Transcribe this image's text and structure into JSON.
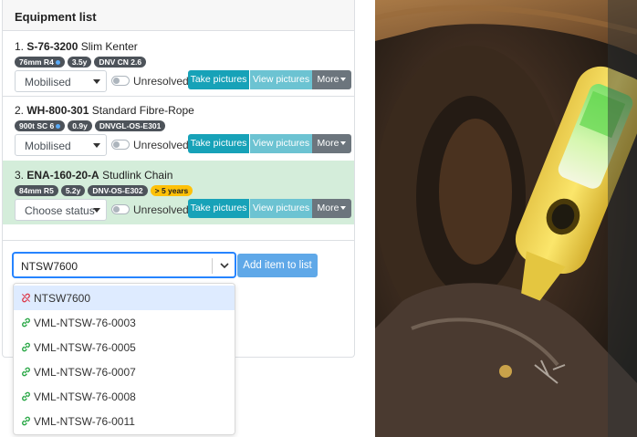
{
  "equipment": {
    "title": "Equipment list",
    "items": [
      {
        "number": "1.",
        "code": "S-76-3200",
        "name": "Slim Kenter",
        "badges": [
          "76mm R4",
          "3.5y",
          "DNV CN 2.6"
        ],
        "status": "Mobilised",
        "toggle_label": "Unresolved",
        "take_label": "Take pictures",
        "view_label": "View pictures",
        "more_label": "More"
      },
      {
        "number": "2.",
        "code": "WH-800-301",
        "name": "Standard Fibre-Rope",
        "badges": [
          "900t SC 6",
          "0.9y",
          "DNVGL-OS-E301"
        ],
        "status": "Mobilised",
        "toggle_label": "Unresolved",
        "take_label": "Take pictures",
        "view_label": "View pictures",
        "more_label": "More"
      },
      {
        "number": "3.",
        "code": "ENA-160-20-A",
        "name": "Studlink Chain",
        "badges": [
          "84mm R5",
          "5.2y",
          "DNV-OS-E302"
        ],
        "warning_badge": "> 5 years",
        "status": "Choose status",
        "toggle_label": "Unresolved",
        "take_label": "Take pictures",
        "view_label": "View pictures",
        "more_label": "More"
      }
    ]
  },
  "add_item": {
    "search_value": "NTSW7600",
    "button_label": "Add item to list",
    "options": [
      {
        "label": "NTSW7600",
        "icon": "unlinked-icon",
        "active": true
      },
      {
        "label": "VML-NTSW-76-0003",
        "icon": "link-icon"
      },
      {
        "label": "VML-NTSW-76-0005",
        "icon": "link-icon"
      },
      {
        "label": "VML-NTSW-76-0007",
        "icon": "link-icon"
      },
      {
        "label": "VML-NTSW-76-0008",
        "icon": "link-icon"
      },
      {
        "label": "VML-NTSW-76-0011",
        "icon": "link-icon"
      }
    ]
  },
  "colors": {
    "primary_info": "#17a2b8",
    "info_light": "#6cc3d2",
    "secondary": "#6c757d",
    "highlight_row": "#d4edda",
    "warning": "#ffc107",
    "link_green": "#28a745",
    "unlinked_red": "#dc3545"
  }
}
